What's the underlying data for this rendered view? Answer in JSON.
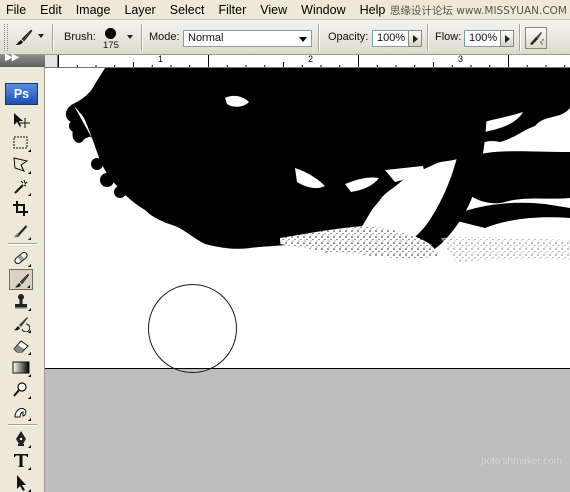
{
  "menubar": {
    "items": [
      "File",
      "Edit",
      "Image",
      "Layer",
      "Select",
      "Filter",
      "View",
      "Window",
      "Help"
    ],
    "watermark": "思缘设计论坛 www.MISSYUAN.COM"
  },
  "options": {
    "brush_label": "Brush:",
    "brush_size": "175",
    "mode_label": "Mode:",
    "mode_value": "Normal",
    "opacity_label": "Opacity:",
    "opacity_value": "100%",
    "flow_label": "Flow:",
    "flow_value": "100%"
  },
  "toolbox": {
    "logo": "Ps",
    "active_tool": "brush-tool"
  },
  "ruler": {
    "labels": [
      "1",
      "2",
      "3"
    ]
  },
  "footer": {
    "watermark": "poto’shmaker.com"
  },
  "colors": {
    "canvas": "#ffffff",
    "pasteboard": "#bdbdbd",
    "chrome": "#ece9d8",
    "foliage": "#000000"
  }
}
